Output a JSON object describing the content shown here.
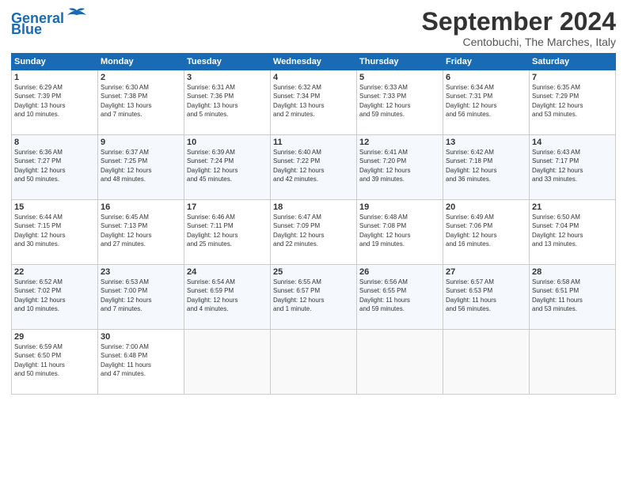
{
  "header": {
    "logo_general": "General",
    "logo_blue": "Blue",
    "month_year": "September 2024",
    "location": "Centobuchi, The Marches, Italy"
  },
  "weekdays": [
    "Sunday",
    "Monday",
    "Tuesday",
    "Wednesday",
    "Thursday",
    "Friday",
    "Saturday"
  ],
  "weeks": [
    [
      {
        "day": "1",
        "lines": [
          "Sunrise: 6:29 AM",
          "Sunset: 7:39 PM",
          "Daylight: 13 hours",
          "and 10 minutes."
        ]
      },
      {
        "day": "2",
        "lines": [
          "Sunrise: 6:30 AM",
          "Sunset: 7:38 PM",
          "Daylight: 13 hours",
          "and 7 minutes."
        ]
      },
      {
        "day": "3",
        "lines": [
          "Sunrise: 6:31 AM",
          "Sunset: 7:36 PM",
          "Daylight: 13 hours",
          "and 5 minutes."
        ]
      },
      {
        "day": "4",
        "lines": [
          "Sunrise: 6:32 AM",
          "Sunset: 7:34 PM",
          "Daylight: 13 hours",
          "and 2 minutes."
        ]
      },
      {
        "day": "5",
        "lines": [
          "Sunrise: 6:33 AM",
          "Sunset: 7:33 PM",
          "Daylight: 12 hours",
          "and 59 minutes."
        ]
      },
      {
        "day": "6",
        "lines": [
          "Sunrise: 6:34 AM",
          "Sunset: 7:31 PM",
          "Daylight: 12 hours",
          "and 56 minutes."
        ]
      },
      {
        "day": "7",
        "lines": [
          "Sunrise: 6:35 AM",
          "Sunset: 7:29 PM",
          "Daylight: 12 hours",
          "and 53 minutes."
        ]
      }
    ],
    [
      {
        "day": "8",
        "lines": [
          "Sunrise: 6:36 AM",
          "Sunset: 7:27 PM",
          "Daylight: 12 hours",
          "and 50 minutes."
        ]
      },
      {
        "day": "9",
        "lines": [
          "Sunrise: 6:37 AM",
          "Sunset: 7:25 PM",
          "Daylight: 12 hours",
          "and 48 minutes."
        ]
      },
      {
        "day": "10",
        "lines": [
          "Sunrise: 6:39 AM",
          "Sunset: 7:24 PM",
          "Daylight: 12 hours",
          "and 45 minutes."
        ]
      },
      {
        "day": "11",
        "lines": [
          "Sunrise: 6:40 AM",
          "Sunset: 7:22 PM",
          "Daylight: 12 hours",
          "and 42 minutes."
        ]
      },
      {
        "day": "12",
        "lines": [
          "Sunrise: 6:41 AM",
          "Sunset: 7:20 PM",
          "Daylight: 12 hours",
          "and 39 minutes."
        ]
      },
      {
        "day": "13",
        "lines": [
          "Sunrise: 6:42 AM",
          "Sunset: 7:18 PM",
          "Daylight: 12 hours",
          "and 36 minutes."
        ]
      },
      {
        "day": "14",
        "lines": [
          "Sunrise: 6:43 AM",
          "Sunset: 7:17 PM",
          "Daylight: 12 hours",
          "and 33 minutes."
        ]
      }
    ],
    [
      {
        "day": "15",
        "lines": [
          "Sunrise: 6:44 AM",
          "Sunset: 7:15 PM",
          "Daylight: 12 hours",
          "and 30 minutes."
        ]
      },
      {
        "day": "16",
        "lines": [
          "Sunrise: 6:45 AM",
          "Sunset: 7:13 PM",
          "Daylight: 12 hours",
          "and 27 minutes."
        ]
      },
      {
        "day": "17",
        "lines": [
          "Sunrise: 6:46 AM",
          "Sunset: 7:11 PM",
          "Daylight: 12 hours",
          "and 25 minutes."
        ]
      },
      {
        "day": "18",
        "lines": [
          "Sunrise: 6:47 AM",
          "Sunset: 7:09 PM",
          "Daylight: 12 hours",
          "and 22 minutes."
        ]
      },
      {
        "day": "19",
        "lines": [
          "Sunrise: 6:48 AM",
          "Sunset: 7:08 PM",
          "Daylight: 12 hours",
          "and 19 minutes."
        ]
      },
      {
        "day": "20",
        "lines": [
          "Sunrise: 6:49 AM",
          "Sunset: 7:06 PM",
          "Daylight: 12 hours",
          "and 16 minutes."
        ]
      },
      {
        "day": "21",
        "lines": [
          "Sunrise: 6:50 AM",
          "Sunset: 7:04 PM",
          "Daylight: 12 hours",
          "and 13 minutes."
        ]
      }
    ],
    [
      {
        "day": "22",
        "lines": [
          "Sunrise: 6:52 AM",
          "Sunset: 7:02 PM",
          "Daylight: 12 hours",
          "and 10 minutes."
        ]
      },
      {
        "day": "23",
        "lines": [
          "Sunrise: 6:53 AM",
          "Sunset: 7:00 PM",
          "Daylight: 12 hours",
          "and 7 minutes."
        ]
      },
      {
        "day": "24",
        "lines": [
          "Sunrise: 6:54 AM",
          "Sunset: 6:59 PM",
          "Daylight: 12 hours",
          "and 4 minutes."
        ]
      },
      {
        "day": "25",
        "lines": [
          "Sunrise: 6:55 AM",
          "Sunset: 6:57 PM",
          "Daylight: 12 hours",
          "and 1 minute."
        ]
      },
      {
        "day": "26",
        "lines": [
          "Sunrise: 6:56 AM",
          "Sunset: 6:55 PM",
          "Daylight: 11 hours",
          "and 59 minutes."
        ]
      },
      {
        "day": "27",
        "lines": [
          "Sunrise: 6:57 AM",
          "Sunset: 6:53 PM",
          "Daylight: 11 hours",
          "and 56 minutes."
        ]
      },
      {
        "day": "28",
        "lines": [
          "Sunrise: 6:58 AM",
          "Sunset: 6:51 PM",
          "Daylight: 11 hours",
          "and 53 minutes."
        ]
      }
    ],
    [
      {
        "day": "29",
        "lines": [
          "Sunrise: 6:59 AM",
          "Sunset: 6:50 PM",
          "Daylight: 11 hours",
          "and 50 minutes."
        ]
      },
      {
        "day": "30",
        "lines": [
          "Sunrise: 7:00 AM",
          "Sunset: 6:48 PM",
          "Daylight: 11 hours",
          "and 47 minutes."
        ]
      },
      {
        "day": "",
        "lines": []
      },
      {
        "day": "",
        "lines": []
      },
      {
        "day": "",
        "lines": []
      },
      {
        "day": "",
        "lines": []
      },
      {
        "day": "",
        "lines": []
      }
    ]
  ]
}
